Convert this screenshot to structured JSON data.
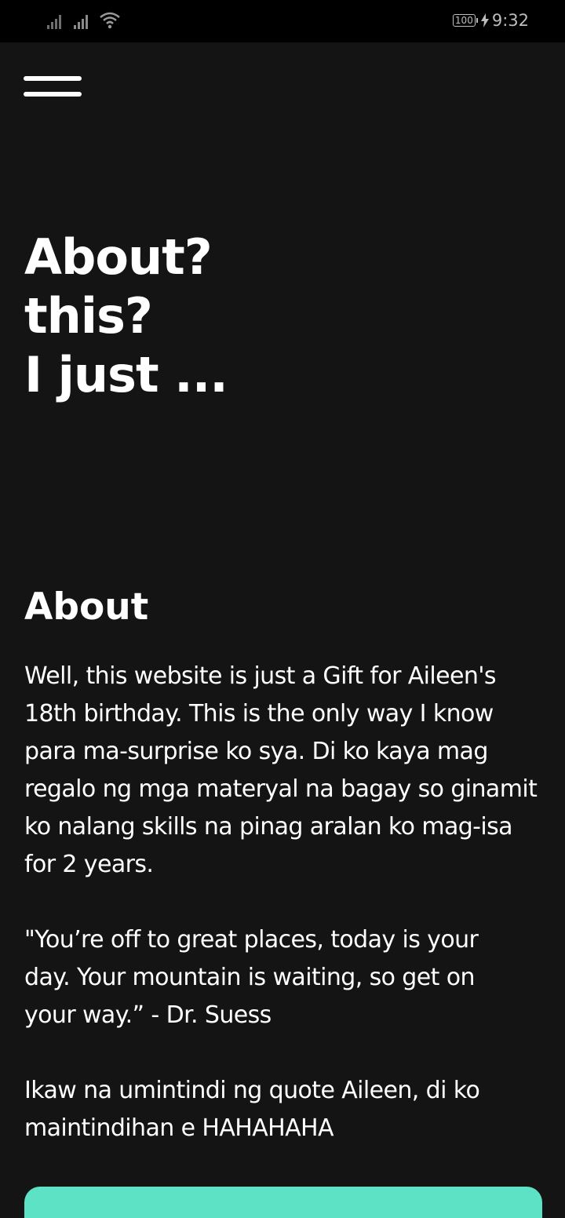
{
  "status_bar": {
    "battery": "100",
    "time": "9:32"
  },
  "hero": {
    "lines": [
      "About?",
      "this?",
      "I just ..."
    ]
  },
  "about": {
    "heading": "About",
    "paragraph1": [
      "Well, this website is just a Gift for Aileen's",
      "18th birthday. This is the only way I know",
      "para ma-surprise ko sya. Di ko kaya mag",
      "regalo ng mga materyal na bagay so ginamit",
      "ko nalang skills na pinag aralan ko mag-isa",
      "for 2 years."
    ],
    "paragraph2": [
      "\"You’re off to great places, today is your",
      "day. Your mountain is waiting, so get on",
      "your way.” - Dr. Suess"
    ],
    "paragraph3": [
      "Ikaw na umintindi ng quote Aileen, di ko",
      "maintindihan e HAHAHAHA"
    ]
  },
  "colors": {
    "background": "#141414",
    "status_bar": "#000000",
    "accent": "#5ee2c5"
  },
  "icons": [
    "signal-icon",
    "signal-icon",
    "wifi-icon",
    "battery-icon",
    "charging-icon",
    "hamburger-menu-icon"
  ]
}
